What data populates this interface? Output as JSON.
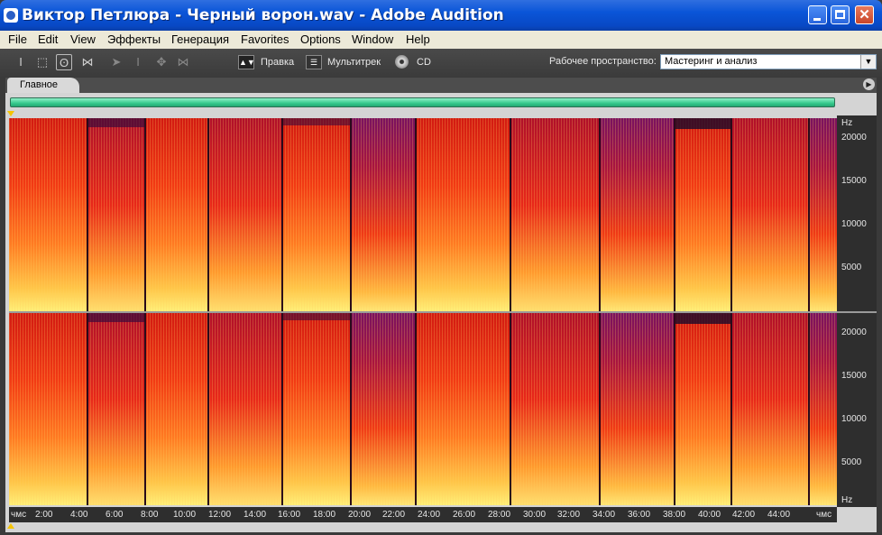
{
  "window": {
    "title": "Виктор Петлюра - Черный ворон.wav - Adobe Audition"
  },
  "menu": [
    "File",
    "Edit",
    "View",
    "Эффекты",
    "Генерация",
    "Favorites",
    "Options",
    "Window",
    "Help"
  ],
  "toolbar": {
    "modes": [
      "Правка",
      "Мультитрек",
      "CD"
    ],
    "workspace_label": "Рабочее пространство:",
    "workspace_value": "Мастеринг и анализ"
  },
  "panel": {
    "tab_label": "Главное"
  },
  "spectrogram": {
    "channels": 2,
    "freq_unit": "Hz",
    "freq_ticks": [
      "20000",
      "15000",
      "10000",
      "5000"
    ],
    "time_ticks": [
      "чмс",
      "2:00",
      "4:00",
      "6:00",
      "8:00",
      "10:00",
      "12:00",
      "14:00",
      "16:00",
      "18:00",
      "20:00",
      "22:00",
      "24:00",
      "26:00",
      "28:00",
      "30:00",
      "32:00",
      "34:00",
      "36:00",
      "38:00",
      "40:00",
      "42:00",
      "44:00",
      "чмс"
    ]
  },
  "colors": {
    "title_bar": "#0a55d8",
    "overview_bar": "#36c98c",
    "spectrum_hot": "#ffe27a",
    "spectrum_mid": "#ff4a1a",
    "spectrum_cool": "#8a1a6a"
  }
}
